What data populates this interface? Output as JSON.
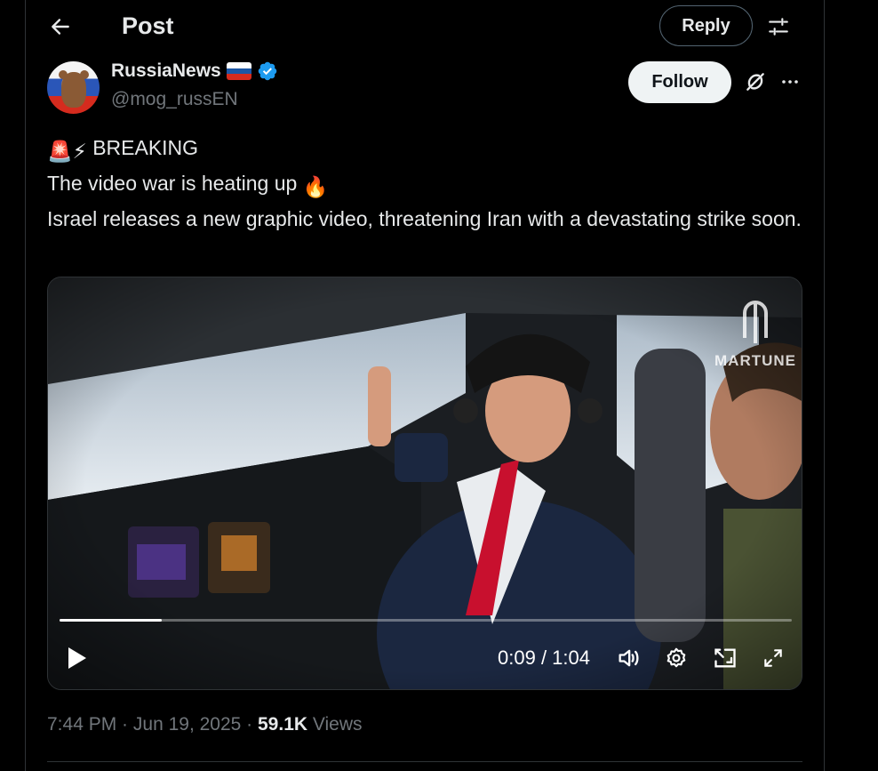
{
  "header": {
    "title": "Post",
    "reply_label": "Reply",
    "back_icon": "arrow-left-icon",
    "filter_icon": "sliders-icon"
  },
  "author": {
    "name": "RussiaNews",
    "handle": "@mog_russEN",
    "flag": "russia-flag-icon",
    "verified": true,
    "follow_label": "Follow"
  },
  "post": {
    "lines": [
      "BREAKING",
      "The video war is heating up",
      "Israel releases a new graphic video, threatening Iran with a devastating strike soon."
    ],
    "emojis": {
      "siren": "🚨",
      "lightning": "⚡",
      "fire": "🔥"
    }
  },
  "video": {
    "current_time": "0:09",
    "separator": " / ",
    "duration": "1:04",
    "progress_fraction": 0.14,
    "watermark": "MARTUNE"
  },
  "footer": {
    "time": "7:44 PM",
    "dot": " · ",
    "date": "Jun 19, 2025",
    "views_count": "59.1K",
    "views_label": "Views"
  },
  "colors": {
    "background": "#000000",
    "text": "#e7e9ea",
    "muted": "#71767b",
    "verified": "#1d9bf0",
    "border": "#2f3336"
  }
}
